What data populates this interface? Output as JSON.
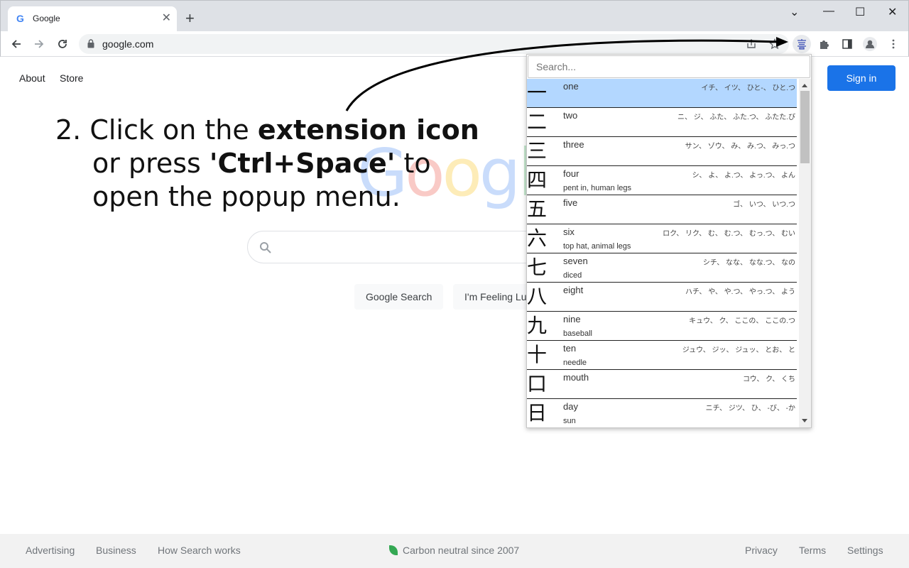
{
  "browser": {
    "tab_title": "Google",
    "new_tab_symbol": "+",
    "tab_close_symbol": "✕",
    "url": "google.com",
    "window_controls": {
      "menu": "⌄",
      "minimize": "—",
      "maximize": "☐",
      "close": "✕"
    }
  },
  "google": {
    "nav_about": "About",
    "nav_store": "Store",
    "sign_in": "Sign in",
    "logo_text": "Google",
    "search_button": "Google Search",
    "lucky_button": "I'm Feeling Lucky",
    "footer": {
      "advertising": "Advertising",
      "business": "Business",
      "how_search_works": "How Search works",
      "carbon": "Carbon neutral since 2007",
      "privacy": "Privacy",
      "terms": "Terms",
      "settings": "Settings"
    }
  },
  "instruction": {
    "line1_prefix": "2. Click on the ",
    "line1_bold": "extension icon",
    "line2_prefix": "or press ",
    "line2_bold": "'Ctrl+Space'",
    "line2_suffix": " to",
    "line3": "open the popup menu."
  },
  "popup": {
    "search_placeholder": "Search...",
    "kanji": [
      {
        "char": "一",
        "meaning": "one",
        "reading": "イチ、 イツ、 ひと-、 ひと.つ",
        "mnemonic": ""
      },
      {
        "char": "二",
        "meaning": "two",
        "reading": "ニ、 ジ、 ふた、 ふた.つ、 ふたた.び",
        "mnemonic": ""
      },
      {
        "char": "三",
        "meaning": "three",
        "reading": "サン、 ゾウ、 み、 み.つ、 みっ.つ",
        "mnemonic": ""
      },
      {
        "char": "四",
        "meaning": "four",
        "reading": "シ、 よ、 よ.つ、 よっ.つ、 よん",
        "mnemonic": "pent in, human legs"
      },
      {
        "char": "五",
        "meaning": "five",
        "reading": "ゴ、 いつ、 いつ.つ",
        "mnemonic": ""
      },
      {
        "char": "六",
        "meaning": "six",
        "reading": "ロク、 リク、 む、 む.つ、 むっ.つ、 むい",
        "mnemonic": "top hat, animal legs"
      },
      {
        "char": "七",
        "meaning": "seven",
        "reading": "シチ、 なな、 なな.つ、 なの",
        "mnemonic": "diced"
      },
      {
        "char": "八",
        "meaning": "eight",
        "reading": "ハチ、 や、 や.つ、 やっ.つ、 よう",
        "mnemonic": ""
      },
      {
        "char": "九",
        "meaning": "nine",
        "reading": "キュウ、 ク、 ここの、 ここの.つ",
        "mnemonic": "baseball"
      },
      {
        "char": "十",
        "meaning": "ten",
        "reading": "ジュウ、 ジッ、 ジュッ、 とお、 と",
        "mnemonic": "needle"
      },
      {
        "char": "口",
        "meaning": "mouth",
        "reading": "コウ、 ク、 くち",
        "mnemonic": ""
      },
      {
        "char": "日",
        "meaning": "day",
        "reading": "ニチ、 ジツ、 ひ、 -び、 -か",
        "mnemonic": "sun"
      }
    ]
  }
}
